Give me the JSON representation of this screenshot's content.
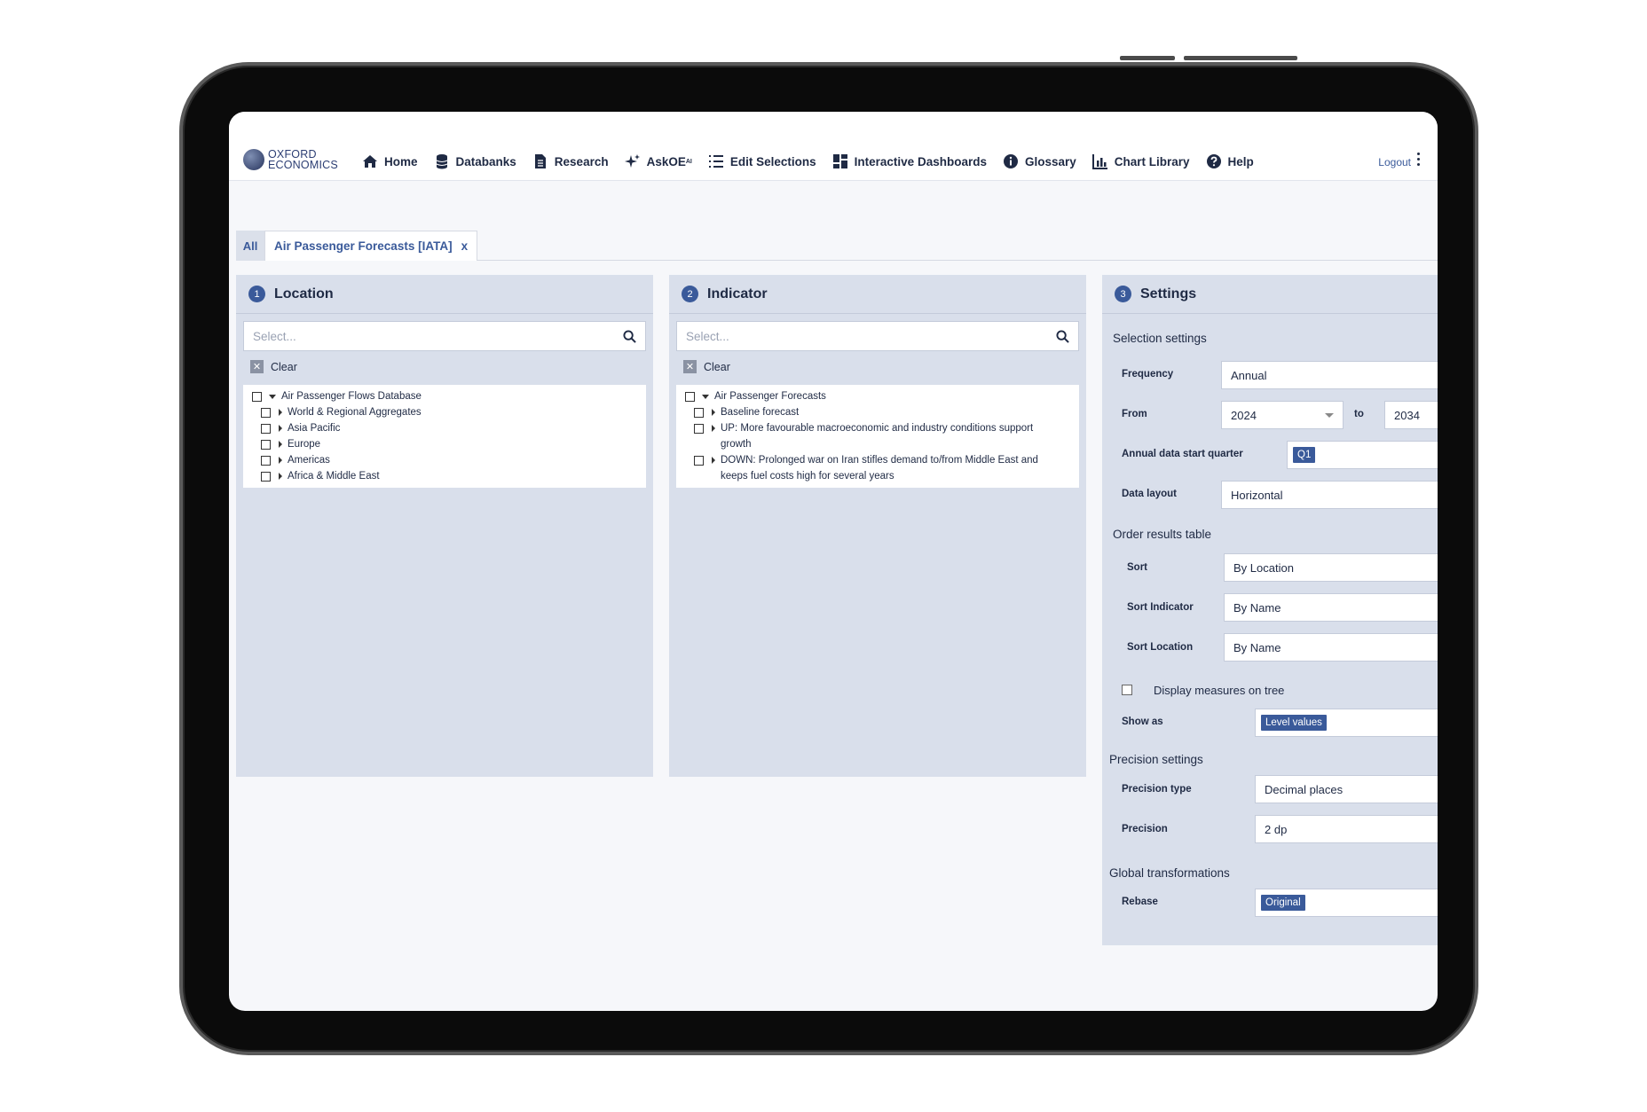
{
  "nav": {
    "logo_line1": "OXFORD",
    "logo_line2": "ECONOMICS",
    "items": [
      {
        "label": "Home",
        "icon": "home-icon"
      },
      {
        "label": "Databanks",
        "icon": "database-icon"
      },
      {
        "label": "Research",
        "icon": "document-icon"
      },
      {
        "label": "AskOE",
        "sup": "AI",
        "icon": "sparkle-icon"
      },
      {
        "label": "Edit Selections",
        "icon": "list-icon"
      },
      {
        "label": "Interactive Dashboards",
        "icon": "dashboard-icon"
      },
      {
        "label": "Glossary",
        "icon": "info-icon"
      },
      {
        "label": "Chart Library",
        "icon": "chart-icon"
      },
      {
        "label": "Help",
        "icon": "help-icon"
      }
    ],
    "logout": "Logout"
  },
  "tabs": {
    "all": "All",
    "current": "Air Passenger Forecasts [IATA]",
    "close": "x"
  },
  "location": {
    "num": "1",
    "title": "Location",
    "search_placeholder": "Select...",
    "clear": "Clear",
    "tree": [
      {
        "label": "Air Passenger Flows Database",
        "level": 0,
        "expanded": true
      },
      {
        "label": "World & Regional Aggregates",
        "level": 1
      },
      {
        "label": "Asia Pacific",
        "level": 1
      },
      {
        "label": "Europe",
        "level": 1
      },
      {
        "label": "Americas",
        "level": 1
      },
      {
        "label": "Africa & Middle East",
        "level": 1
      }
    ]
  },
  "indicator": {
    "num": "2",
    "title": "Indicator",
    "search_placeholder": "Select...",
    "clear": "Clear",
    "root": "Air Passenger Forecasts",
    "items": [
      "Baseline forecast",
      "UP: More favourable macroeconomic and industry conditions support growth",
      "DOWN: Prolonged war on Iran stifles demand to/from Middle East and keeps fuel costs high for several years"
    ]
  },
  "settings": {
    "num": "3",
    "title": "Settings",
    "selection_heading": "Selection settings",
    "frequency_label": "Frequency",
    "frequency_value": "Annual",
    "from_label": "From",
    "from_value": "2024",
    "to_label": "to",
    "to_value": "2034",
    "quarter_label": "Annual data start quarter",
    "quarter_value": "Q1",
    "layout_label": "Data layout",
    "layout_value": "Horizontal",
    "order_heading": "Order results table",
    "sort_label": "Sort",
    "sort_value": "By Location",
    "sort_indicator_label": "Sort Indicator",
    "sort_indicator_value": "By Name",
    "sort_location_label": "Sort Location",
    "sort_location_value": "By Name",
    "display_measures_label": "Display measures on tree",
    "show_as_label": "Show as",
    "show_as_value": "Level values",
    "precision_heading": "Precision settings",
    "precision_type_label": "Precision type",
    "precision_type_value": "Decimal places",
    "precision_label": "Precision",
    "precision_value": "2 dp",
    "global_heading": "Global transformations",
    "rebase_label": "Rebase",
    "rebase_value": "Original"
  },
  "colors": {
    "accent": "#3a5a9a",
    "panel": "#d9dfeb",
    "text": "#1f2a44"
  }
}
